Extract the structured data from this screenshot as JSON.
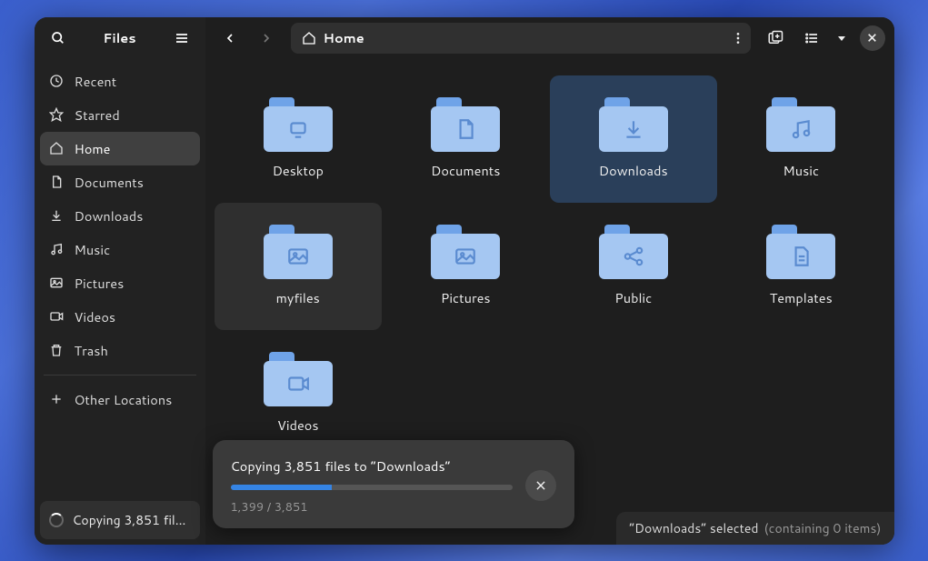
{
  "app_title": "Files",
  "path_label": "Home",
  "sidebar": {
    "items": [
      {
        "icon": "clock",
        "label": "Recent"
      },
      {
        "icon": "star",
        "label": "Starred"
      },
      {
        "icon": "home",
        "label": "Home",
        "active": true
      },
      {
        "icon": "doc",
        "label": "Documents"
      },
      {
        "icon": "download",
        "label": "Downloads"
      },
      {
        "icon": "music",
        "label": "Music"
      },
      {
        "icon": "picture",
        "label": "Pictures"
      },
      {
        "icon": "video",
        "label": "Videos"
      },
      {
        "icon": "trash",
        "label": "Trash"
      }
    ],
    "other_locations": "Other Locations",
    "status": "Copying 3,851 fil…"
  },
  "folders": [
    {
      "name": "Desktop",
      "glyph": "desktop"
    },
    {
      "name": "Documents",
      "glyph": "doc"
    },
    {
      "name": "Downloads",
      "glyph": "download",
      "selected": true
    },
    {
      "name": "Music",
      "glyph": "music"
    },
    {
      "name": "myfiles",
      "glyph": "picture",
      "hover": true
    },
    {
      "name": "Pictures",
      "glyph": "picture"
    },
    {
      "name": "Public",
      "glyph": "share"
    },
    {
      "name": "Templates",
      "glyph": "template"
    },
    {
      "name": "Videos",
      "glyph": "video"
    }
  ],
  "popover": {
    "title": "Copying 3,851 files to “Downloads”",
    "progress_text": "1,399 / 3,851",
    "progress_pct": 36
  },
  "statusbar": {
    "primary": "“Downloads” selected",
    "secondary": "(containing 0 items)"
  }
}
